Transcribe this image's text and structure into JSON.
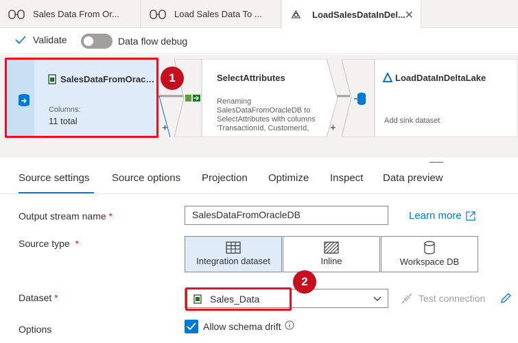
{
  "tabs": [
    {
      "label": "Sales Data From Or...",
      "icon": "dataflow-icon"
    },
    {
      "label": "Load Sales Data To ...",
      "icon": "dataflow-icon"
    },
    {
      "label": "LoadSalesDataInDel...",
      "icon": "dataflow-active-icon",
      "close": "✕"
    }
  ],
  "toolbar": {
    "validate_label": "Validate",
    "debug_label": "Data flow debug"
  },
  "nodes": {
    "source": {
      "title": "SalesDataFromOracl...",
      "columns_label": "Columns:",
      "columns_value": "11 total"
    },
    "select": {
      "title": "SelectAttributes",
      "description_lines": [
        "Renaming",
        "SalesDataFromOracleDB to",
        "SelectAttributes with columns",
        "'TransactionId, CustomerId,"
      ]
    },
    "sink": {
      "title": "LoadDataInDeltaLake",
      "subtitle": "Add sink dataset"
    }
  },
  "callouts": {
    "one": "1",
    "two": "2"
  },
  "plus": "+",
  "settings_tabs": [
    "Source settings",
    "Source options",
    "Projection",
    "Optimize",
    "Inspect",
    "Data preview"
  ],
  "form": {
    "output_stream_label": "Output stream name",
    "required_mark": "*",
    "output_stream_value": "SalesDataFromOracleDB",
    "learn_more": "Learn more",
    "source_type_label": "Source type",
    "source_types": [
      {
        "label": "Integration dataset",
        "icon": "table-icon",
        "selected": true
      },
      {
        "label": "Inline",
        "icon": "inline-icon",
        "selected": false
      },
      {
        "label": "Workspace DB",
        "icon": "database-icon",
        "selected": false
      }
    ],
    "dataset_label": "Dataset",
    "dataset_value": "Sales_Data",
    "test_connection": "Test connection",
    "options_label": "Options",
    "allow_schema_drift": "Allow schema drift",
    "allow_schema_drift_checked": true
  },
  "colors": {
    "accent": "#0078d4",
    "callout": "#c50f1f",
    "highlight": "#e81123",
    "selected_bg": "#deecf9"
  }
}
